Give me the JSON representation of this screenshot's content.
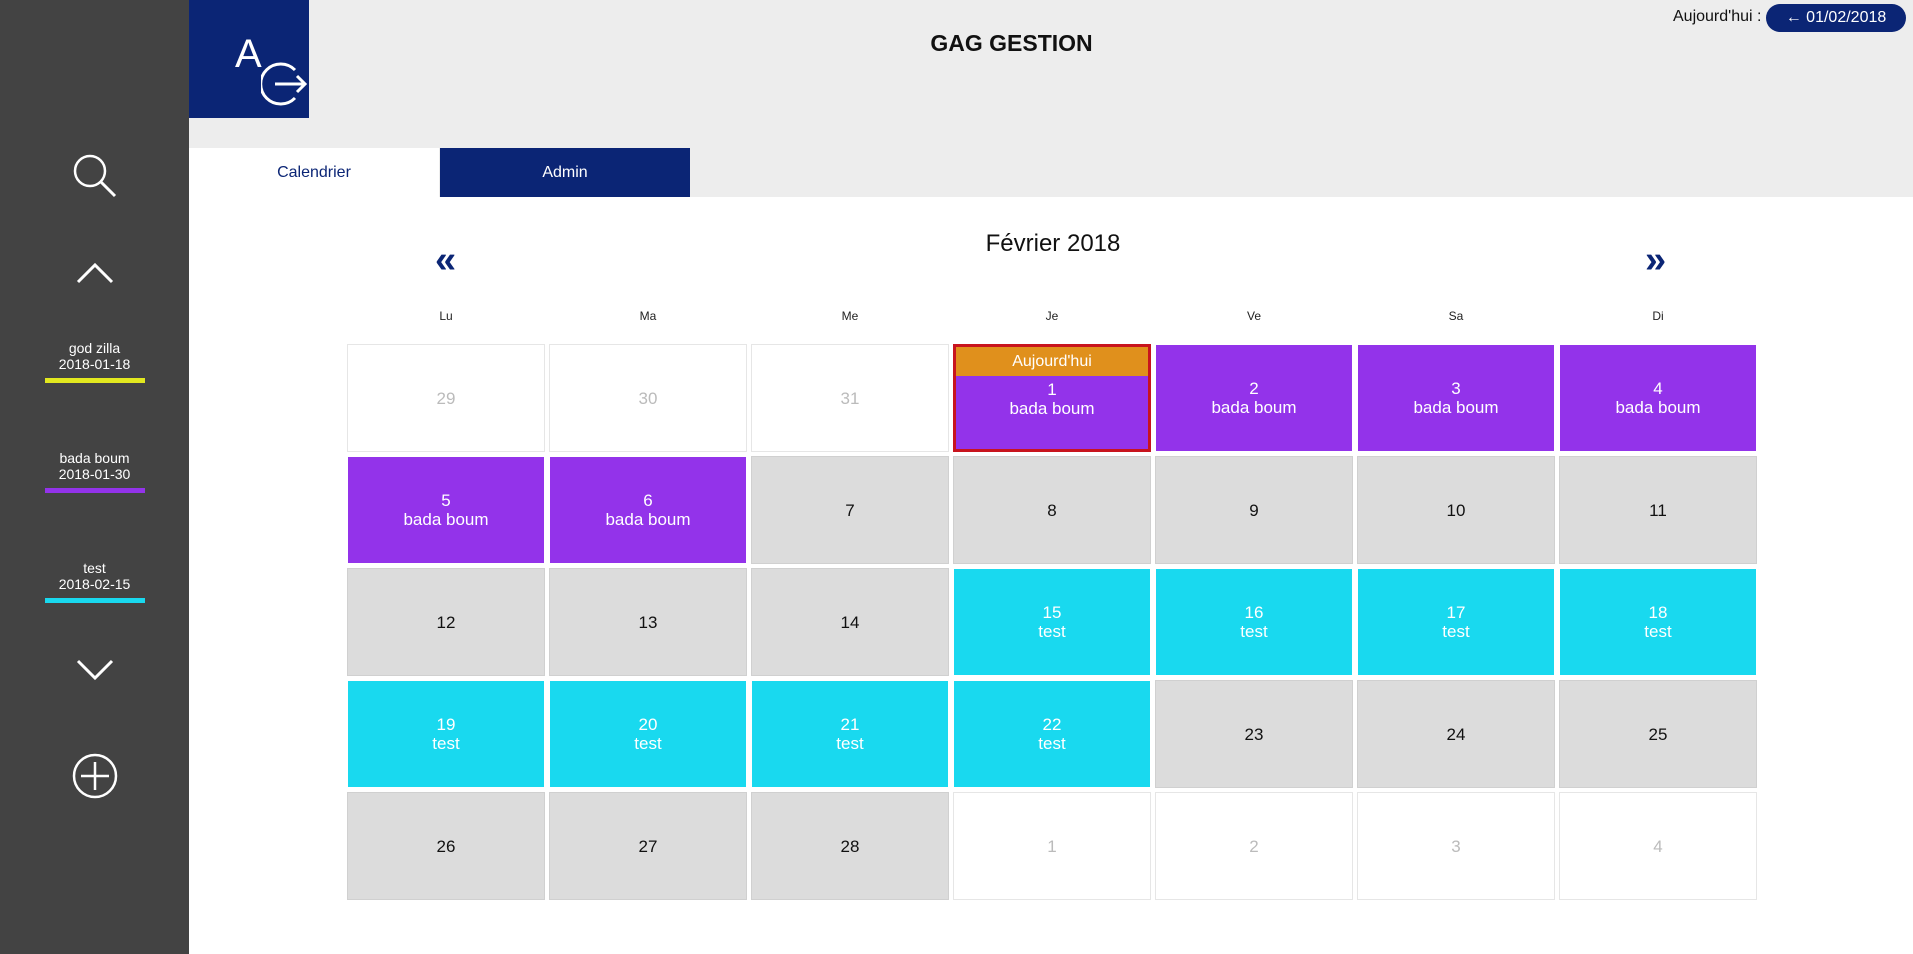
{
  "app": {
    "title": "GAG GESTION",
    "logo_letter": "A",
    "today_label": "Aujourd'hui :",
    "today_button": "← 01/02/2018"
  },
  "tabs": [
    {
      "label": "Calendrier",
      "active": true
    },
    {
      "label": "Admin",
      "active": false
    }
  ],
  "sidebar": {
    "icons": [
      "search-icon",
      "chevron-up-icon",
      "chevron-down-icon",
      "add-circle-icon"
    ],
    "events": [
      {
        "name": "god zilla",
        "date": "2018-01-18",
        "color": "#e2e81f"
      },
      {
        "name": "bada boum",
        "date": "2018-01-30",
        "color": "#9333ea"
      },
      {
        "name": "test",
        "date": "2018-02-15",
        "color": "#19d9ef"
      }
    ]
  },
  "calendar": {
    "month_title": "Février 2018",
    "prev_label": "«",
    "next_label": "»",
    "weekdays": [
      "Lu",
      "Ma",
      "Me",
      "Je",
      "Ve",
      "Sa",
      "Di"
    ],
    "today_banner": "Aujourd'hui",
    "days": [
      {
        "n": "29",
        "event": "",
        "kind": "outside"
      },
      {
        "n": "30",
        "event": "",
        "kind": "outside"
      },
      {
        "n": "31",
        "event": "",
        "kind": "outside"
      },
      {
        "n": "1",
        "event": "bada boum",
        "kind": "purple",
        "today": true
      },
      {
        "n": "2",
        "event": "bada boum",
        "kind": "purple"
      },
      {
        "n": "3",
        "event": "bada boum",
        "kind": "purple"
      },
      {
        "n": "4",
        "event": "bada boum",
        "kind": "purple"
      },
      {
        "n": "5",
        "event": "bada boum",
        "kind": "purple"
      },
      {
        "n": "6",
        "event": "bada boum",
        "kind": "purple"
      },
      {
        "n": "7",
        "event": "",
        "kind": "empty"
      },
      {
        "n": "8",
        "event": "",
        "kind": "empty"
      },
      {
        "n": "9",
        "event": "",
        "kind": "empty"
      },
      {
        "n": "10",
        "event": "",
        "kind": "empty"
      },
      {
        "n": "11",
        "event": "",
        "kind": "empty"
      },
      {
        "n": "12",
        "event": "",
        "kind": "empty"
      },
      {
        "n": "13",
        "event": "",
        "kind": "empty"
      },
      {
        "n": "14",
        "event": "",
        "kind": "empty"
      },
      {
        "n": "15",
        "event": "test",
        "kind": "cyan"
      },
      {
        "n": "16",
        "event": "test",
        "kind": "cyan"
      },
      {
        "n": "17",
        "event": "test",
        "kind": "cyan"
      },
      {
        "n": "18",
        "event": "test",
        "kind": "cyan"
      },
      {
        "n": "19",
        "event": "test",
        "kind": "cyan"
      },
      {
        "n": "20",
        "event": "test",
        "kind": "cyan"
      },
      {
        "n": "21",
        "event": "test",
        "kind": "cyan"
      },
      {
        "n": "22",
        "event": "test",
        "kind": "cyan"
      },
      {
        "n": "23",
        "event": "",
        "kind": "empty"
      },
      {
        "n": "24",
        "event": "",
        "kind": "empty"
      },
      {
        "n": "25",
        "event": "",
        "kind": "empty"
      },
      {
        "n": "26",
        "event": "",
        "kind": "empty"
      },
      {
        "n": "27",
        "event": "",
        "kind": "empty"
      },
      {
        "n": "28",
        "event": "",
        "kind": "empty"
      },
      {
        "n": "1",
        "event": "",
        "kind": "outside"
      },
      {
        "n": "2",
        "event": "",
        "kind": "outside"
      },
      {
        "n": "3",
        "event": "",
        "kind": "outside"
      },
      {
        "n": "4",
        "event": "",
        "kind": "outside"
      }
    ]
  }
}
